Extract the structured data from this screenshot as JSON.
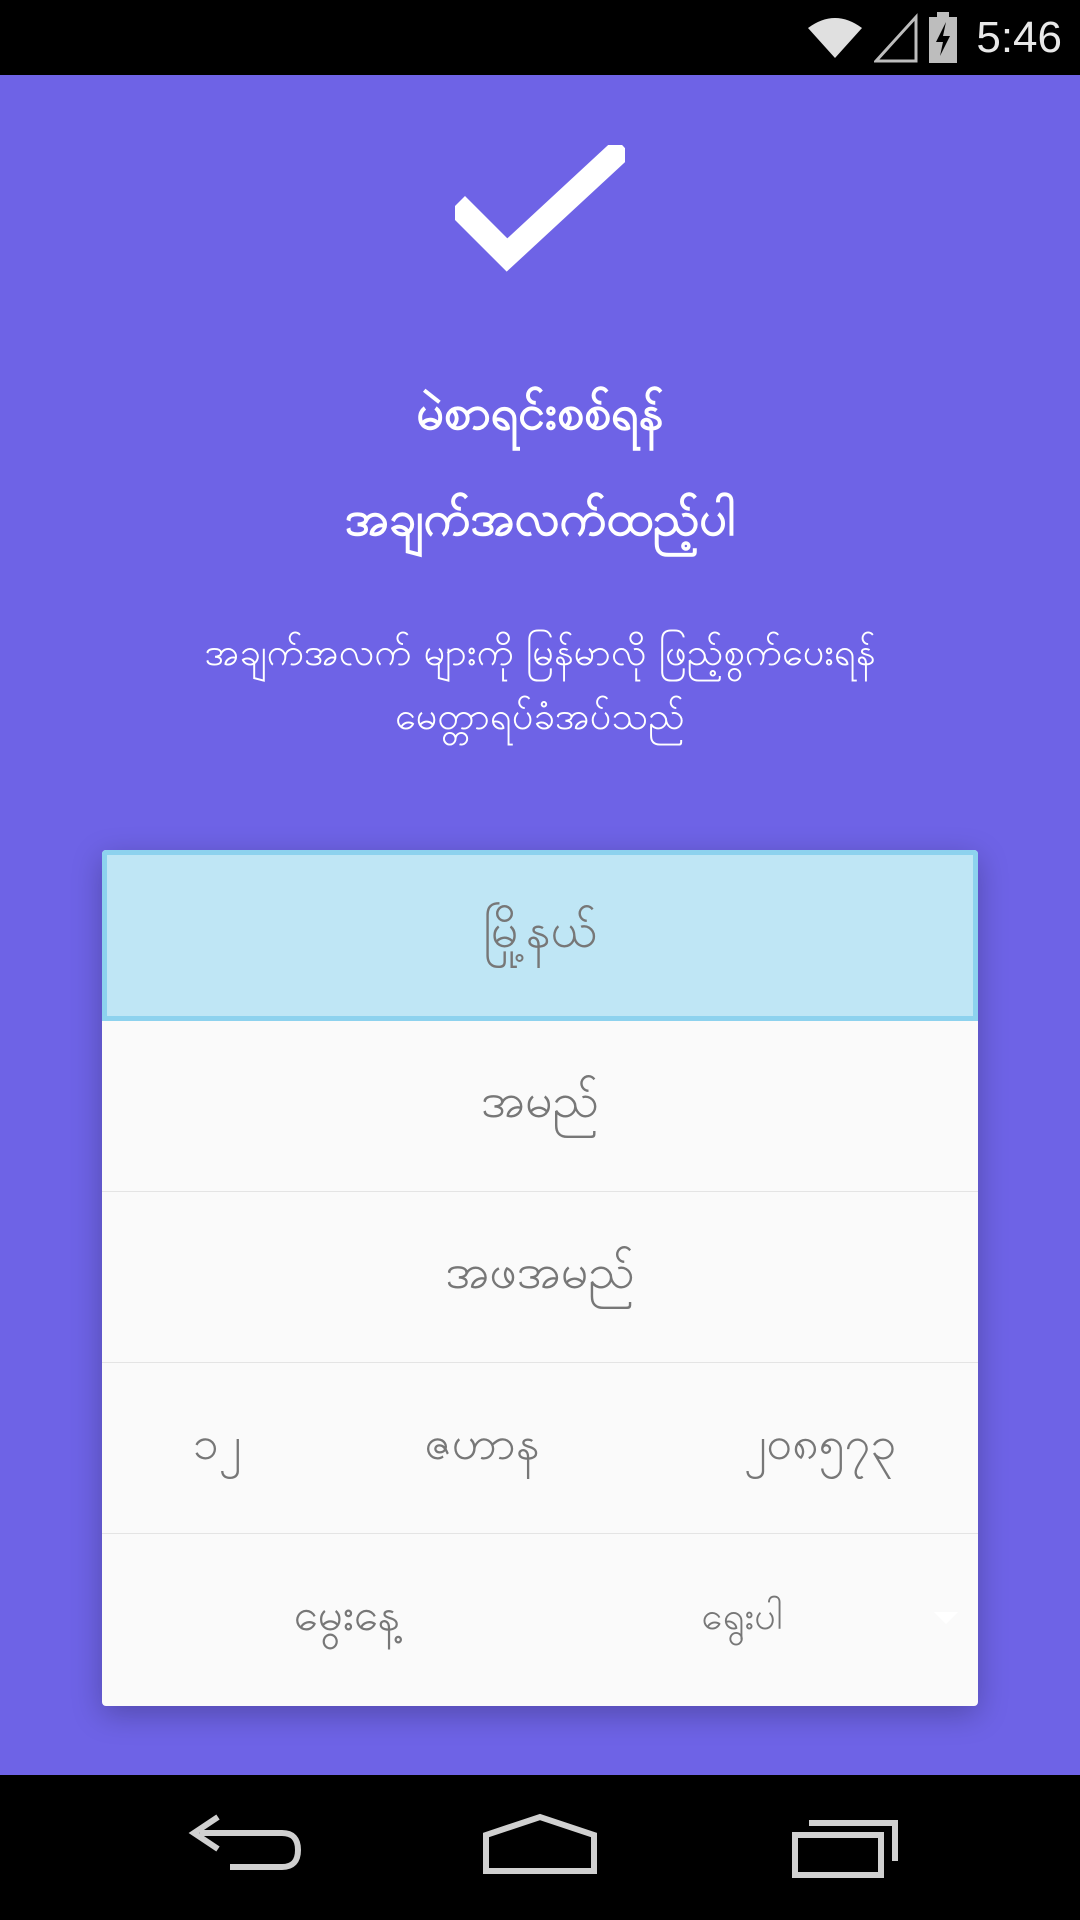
{
  "status_bar": {
    "time": "5:46",
    "icons": [
      "wifi-icon",
      "cell-signal-icon",
      "battery-charging-icon"
    ]
  },
  "header": {
    "icon": "check-icon",
    "title_line1": "မဲစာရင်းစစ်ရန်",
    "title_line2": "အချက်အလက်ထည့်ပါ",
    "subtitle_line1": "အချက်အလက် များကို မြန်မာလို ဖြည့်စွက်ပေးရန်",
    "subtitle_line2": "မေတ္တာရပ်ခံအပ်သည်"
  },
  "form": {
    "township_placeholder": "မြို့နယ်",
    "name_placeholder": "အမည်",
    "father_name_placeholder": "အဖအမည်",
    "dob": {
      "day": "၁၂",
      "month": "ဇဟာန",
      "year": "၂၀၈၅၇၃"
    },
    "gender_label": "မွေးနေ့",
    "gender_select_value": "ရွေးပါ"
  },
  "colors": {
    "background": "#6e63e6",
    "focused_field": "#bfe6f5",
    "focused_border": "#8dd2ee"
  },
  "nav_bar": {
    "icons": [
      "back-icon",
      "home-icon",
      "recent-apps-icon"
    ]
  }
}
